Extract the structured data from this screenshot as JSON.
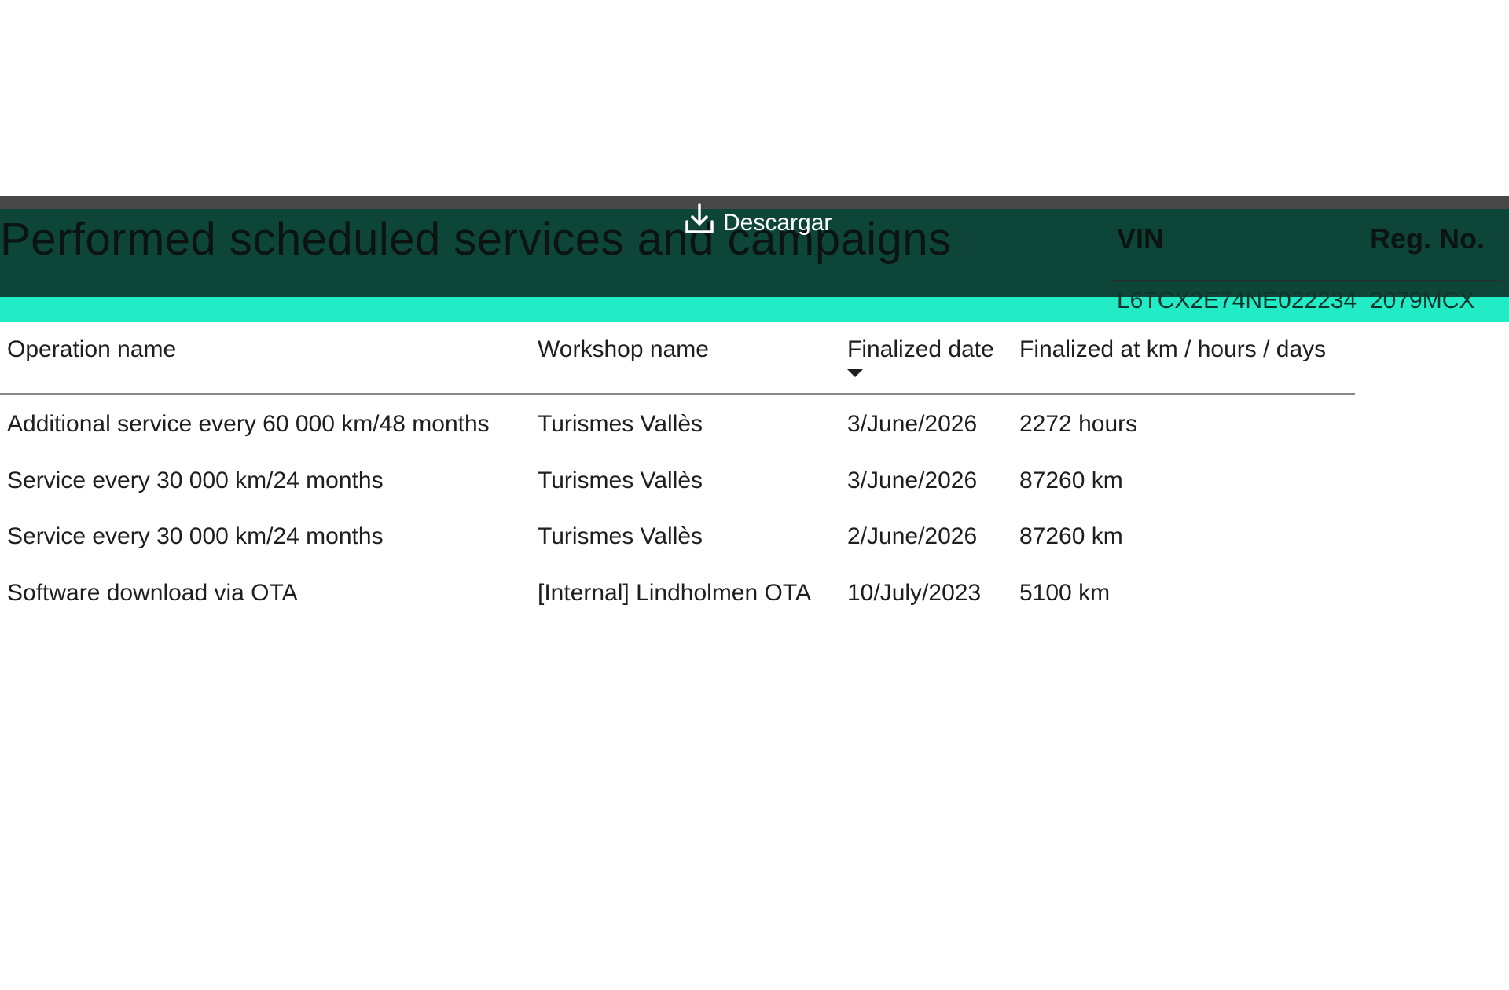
{
  "header": {
    "title": "Performed scheduled services and campaigns",
    "download_label": "Descargar",
    "download_icon": "download-icon",
    "vin_label": "VIN",
    "reg_label": "Reg. No.",
    "vin_value": "L6TCX2E74NE022234",
    "reg_value": "2079MCX"
  },
  "colors": {
    "header_background": "#0d4538",
    "accent_bar": "#22ecc6",
    "top_strip": "#484848"
  },
  "table": {
    "columns": [
      "Operation name",
      "Workshop name",
      "Finalized date",
      "Finalized at km / hours / days"
    ],
    "sorted_column": "Finalized date",
    "sort_direction": "descending",
    "rows": [
      [
        "Additional service every 60 000 km/48 months",
        "Turismes Vallès",
        "3/June/2026",
        "2272 hours"
      ],
      [
        "Service every 30 000 km/24 months",
        "Turismes Vallès",
        "3/June/2026",
        "87260 km"
      ],
      [
        "Service every 30 000 km/24 months",
        "Turismes Vallès",
        "2/June/2026",
        "87260 km"
      ],
      [
        "Software download via OTA",
        "[Internal] Lindholmen OTA",
        "10/July/2023",
        "5100 km"
      ]
    ]
  }
}
